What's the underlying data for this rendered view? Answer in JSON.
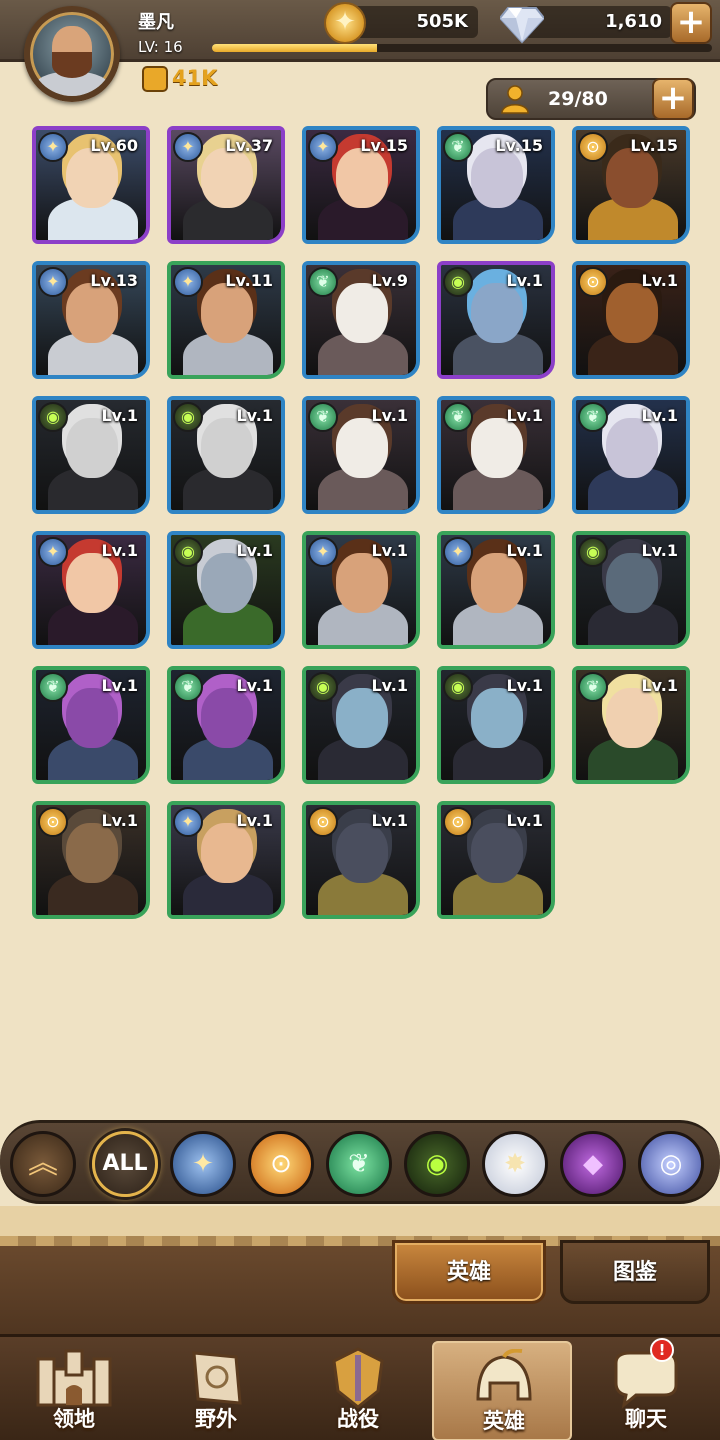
{
  "player": {
    "name": "墨凡",
    "level_label": "LV:",
    "level": "16",
    "xp_fraction": 0.33,
    "power": "41K"
  },
  "resources": {
    "gold": "505K",
    "gems": "1,610"
  },
  "roster": {
    "count": "29/80"
  },
  "colors": {
    "purple_frame": "#8c3fc8",
    "blue_frame": "#2f84c4",
    "green_frame": "#39a35a",
    "accent_gold": "#e4a21e"
  },
  "heroes": [
    {
      "level": "Lv.60",
      "faction": "lightbearer",
      "rarity": "purple",
      "skin": "#f1d3b4",
      "outfit": "#dce6ee",
      "hair": "#e8c270",
      "bg": "#3d4e6c"
    },
    {
      "level": "Lv.37",
      "faction": "lightbearer",
      "rarity": "purple",
      "skin": "#f1d3b4",
      "outfit": "#2b2b2e",
      "hair": "#e8d190",
      "bg": "#5a4a62"
    },
    {
      "level": "Lv.15",
      "faction": "lightbearer",
      "rarity": "blue",
      "skin": "#f1c7a6",
      "outfit": "#2a1a2a",
      "hair": "#c53a30",
      "bg": "#3b2a42"
    },
    {
      "level": "Lv.15",
      "faction": "wilder",
      "rarity": "blue",
      "skin": "#c8c4d8",
      "outfit": "#2e3a5a",
      "hair": "#e6e6f0",
      "bg": "#23314c"
    },
    {
      "level": "Lv.15",
      "faction": "mauler",
      "rarity": "blue",
      "skin": "#8a4e2e",
      "outfit": "#c0892c",
      "hair": "#3a2a1a",
      "bg": "#4a3a2a"
    },
    {
      "level": "Lv.13",
      "faction": "lightbearer",
      "rarity": "blue",
      "skin": "#d8a27a",
      "outfit": "#c9ccd2",
      "hair": "#6b3b20",
      "bg": "#36485a"
    },
    {
      "level": "Lv.11",
      "faction": "lightbearer",
      "rarity": "green",
      "skin": "#d8a27a",
      "outfit": "#b0b6c0",
      "hair": "#5a3018",
      "bg": "#2e3a48"
    },
    {
      "level": "Lv.9",
      "faction": "wilder",
      "rarity": "blue",
      "skin": "#f0ece6",
      "outfit": "#6a5a5a",
      "hair": "#5a3a2a",
      "bg": "#3a3038"
    },
    {
      "level": "Lv.1",
      "faction": "graveborn",
      "rarity": "purple",
      "skin": "#8aa6c8",
      "outfit": "#4a5262",
      "hair": "#6ab0e0",
      "bg": "#2a3240"
    },
    {
      "level": "Lv.1",
      "faction": "mauler",
      "rarity": "blue",
      "skin": "#a0602e",
      "outfit": "#3a2418",
      "hair": "#2a1a10",
      "bg": "#3a2218"
    },
    {
      "level": "Lv.1",
      "faction": "graveborn",
      "rarity": "blue",
      "skin": "#d0d0d0",
      "outfit": "#2a2a2e",
      "hair": "#e0e0e0",
      "bg": "#262a30"
    },
    {
      "level": "Lv.1",
      "faction": "graveborn",
      "rarity": "blue",
      "skin": "#d0d0d0",
      "outfit": "#2a2a2e",
      "hair": "#e0e0e0",
      "bg": "#262a30"
    },
    {
      "level": "Lv.1",
      "faction": "wilder",
      "rarity": "blue",
      "skin": "#f0ece6",
      "outfit": "#6a5a5a",
      "hair": "#5a3a2a",
      "bg": "#3a3038"
    },
    {
      "level": "Lv.1",
      "faction": "wilder",
      "rarity": "blue",
      "skin": "#f0ece6",
      "outfit": "#6a5a5a",
      "hair": "#5a3a2a",
      "bg": "#3a3038"
    },
    {
      "level": "Lv.1",
      "faction": "wilder",
      "rarity": "blue",
      "skin": "#c8c4d8",
      "outfit": "#2e3a5a",
      "hair": "#e6e6f0",
      "bg": "#23314c"
    },
    {
      "level": "Lv.1",
      "faction": "lightbearer",
      "rarity": "blue",
      "skin": "#f1c7a6",
      "outfit": "#2a1a2a",
      "hair": "#c53a30",
      "bg": "#3b2a42"
    },
    {
      "level": "Lv.1",
      "faction": "graveborn",
      "rarity": "blue",
      "skin": "#9aa8b8",
      "outfit": "#3a6a2a",
      "hair": "#c8ccd4",
      "bg": "#2a3a20"
    },
    {
      "level": "Lv.1",
      "faction": "lightbearer",
      "rarity": "green",
      "skin": "#d8a27a",
      "outfit": "#b0b6c0",
      "hair": "#5a3018",
      "bg": "#2e3a48"
    },
    {
      "level": "Lv.1",
      "faction": "lightbearer",
      "rarity": "green",
      "skin": "#d8a27a",
      "outfit": "#b0b6c0",
      "hair": "#5a3018",
      "bg": "#2e3a48"
    },
    {
      "level": "Lv.1",
      "faction": "graveborn",
      "rarity": "green",
      "skin": "#5a6a7a",
      "outfit": "#2a2a34",
      "hair": "#3a3a48",
      "bg": "#22282e"
    },
    {
      "level": "Lv.1",
      "faction": "wilder",
      "rarity": "green",
      "skin": "#8a4aa8",
      "outfit": "#3a4a6a",
      "hair": "#b060c8",
      "bg": "#1e2430"
    },
    {
      "level": "Lv.1",
      "faction": "wilder",
      "rarity": "green",
      "skin": "#8a4aa8",
      "outfit": "#3a4a6a",
      "hair": "#b060c8",
      "bg": "#1e2430"
    },
    {
      "level": "Lv.1",
      "faction": "graveborn",
      "rarity": "green",
      "skin": "#8ab0c8",
      "outfit": "#2a2a34",
      "hair": "#3a3a48",
      "bg": "#22262e"
    },
    {
      "level": "Lv.1",
      "faction": "graveborn",
      "rarity": "green",
      "skin": "#8ab0c8",
      "outfit": "#2a2a34",
      "hair": "#3a3a48",
      "bg": "#22262e"
    },
    {
      "level": "Lv.1",
      "faction": "wilder",
      "rarity": "green",
      "skin": "#f0d0b0",
      "outfit": "#2a4a2a",
      "hair": "#f0e0a0",
      "bg": "#3a3024"
    },
    {
      "level": "Lv.1",
      "faction": "mauler",
      "rarity": "green",
      "skin": "#8a6a4a",
      "outfit": "#3a2a20",
      "hair": "#5a4a3a",
      "bg": "#3a3028"
    },
    {
      "level": "Lv.1",
      "faction": "lightbearer",
      "rarity": "green",
      "skin": "#e8b890",
      "outfit": "#2a2a3a",
      "hair": "#c8a060",
      "bg": "#3a3a4a"
    },
    {
      "level": "Lv.1",
      "faction": "mauler",
      "rarity": "green",
      "skin": "#4a4e5e",
      "outfit": "#8a7a3a",
      "hair": "#3a3e4a",
      "bg": "#2a2c34"
    },
    {
      "level": "Lv.1",
      "faction": "mauler",
      "rarity": "green",
      "skin": "#4a4e5e",
      "outfit": "#8a7a3a",
      "hair": "#3a3e4a",
      "bg": "#2a2c34"
    }
  ],
  "filters": {
    "all_label": "ALL",
    "items": [
      "lightbearer",
      "mauler",
      "wilder",
      "graveborn",
      "celestial",
      "hypogean",
      "dimensional"
    ]
  },
  "tabs": {
    "heroes": "英雄",
    "codex": "图鉴"
  },
  "nav": {
    "items": [
      {
        "label": "领地",
        "icon": "castle-icon"
      },
      {
        "label": "野外",
        "icon": "scroll-map-icon"
      },
      {
        "label": "战役",
        "icon": "sword-shield-icon"
      },
      {
        "label": "英雄",
        "icon": "helmet-icon"
      },
      {
        "label": "聊天",
        "icon": "chat-bubble-icon"
      }
    ],
    "active_index": 3,
    "chat_badge": "!"
  }
}
